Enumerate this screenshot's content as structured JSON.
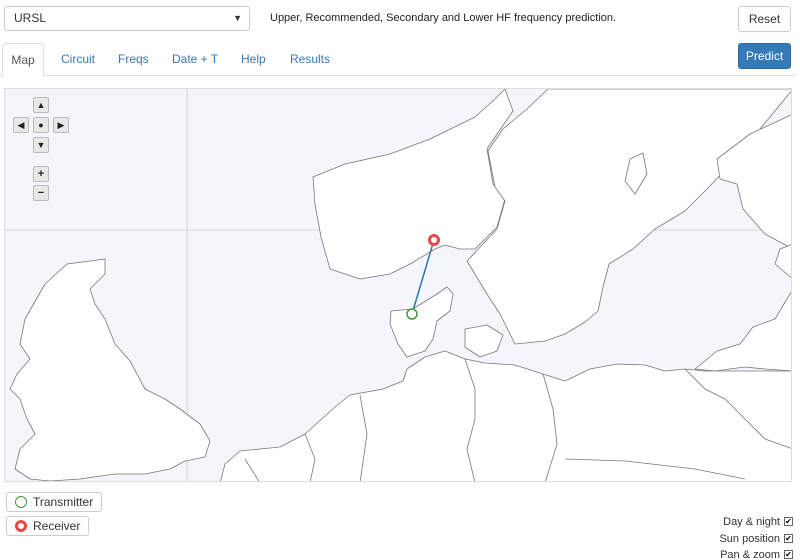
{
  "toolbar": {
    "method_select": "URSL",
    "description": "Upper, Recommended, Secondary and Lower HF frequency prediction.",
    "reset_label": "Reset",
    "predict_label": "Predict"
  },
  "tabs": [
    {
      "label": "Map",
      "active": true
    },
    {
      "label": "Circuit",
      "active": false
    },
    {
      "label": "Freqs",
      "active": false
    },
    {
      "label": "Date + T",
      "active": false
    },
    {
      "label": "Help",
      "active": false
    },
    {
      "label": "Results",
      "active": false
    }
  ],
  "map_controls": {
    "up": "▲",
    "left": "◀",
    "center": "●",
    "right": "▶",
    "down": "▼",
    "zoom_in": "+",
    "zoom_out": "−"
  },
  "legend": {
    "transmitter": "Transmitter",
    "receiver": "Receiver"
  },
  "options": {
    "day_night": "Day & night",
    "sun_position": "Sun position",
    "pan_zoom": "Pan & zoom"
  },
  "colors": {
    "accent": "#337ab7",
    "transmitter": "#3a9a3a",
    "receiver": "#e84848",
    "path": "#2f74b0",
    "sea": "#f4f6fc",
    "land": "#ffffff"
  }
}
